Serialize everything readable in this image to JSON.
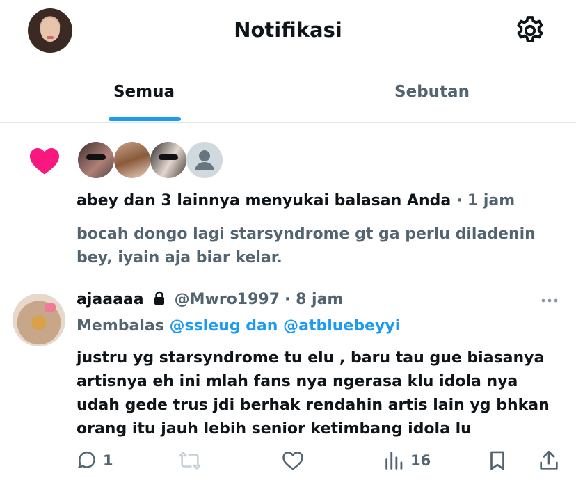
{
  "header": {
    "title": "Notifikasi",
    "avatar_icon": "profile-avatar",
    "settings_icon": "gear-icon"
  },
  "tabs": [
    {
      "label": "Semua",
      "active": true
    },
    {
      "label": "Sebutan",
      "active": false
    }
  ],
  "colors": {
    "accent": "#1d9bf0",
    "like": "#f91880",
    "text": "#0f1419",
    "muted": "#536471",
    "divider": "#e1e6ea"
  },
  "like_notification": {
    "icon": "heart-icon",
    "message": "abey dan 3 lainnya menyukai balasan Anda",
    "time": "· 1 jam",
    "preview": "bocah dongo lagi starsyndrome gt ga perlu diladenin bey, iyain aja biar kelar."
  },
  "tweet": {
    "display_name": "ajaaaaa",
    "handle": "@Mwro1997",
    "time": "· 8 jam",
    "reply_label": "Membalas",
    "reply_users": "@ssleug dan @atbluebeyyi",
    "body": "justru yg starsyndrome tu elu , baru tau gue biasanya artisnya eh ini mlah fans nya ngerasa klu idola nya udah gede trus jdi berhak rendahin artis lain yg bhkan orang itu jauh lebih senior ketimbang idola lu",
    "actions": {
      "reply_count": "1",
      "views_count": "16"
    }
  }
}
